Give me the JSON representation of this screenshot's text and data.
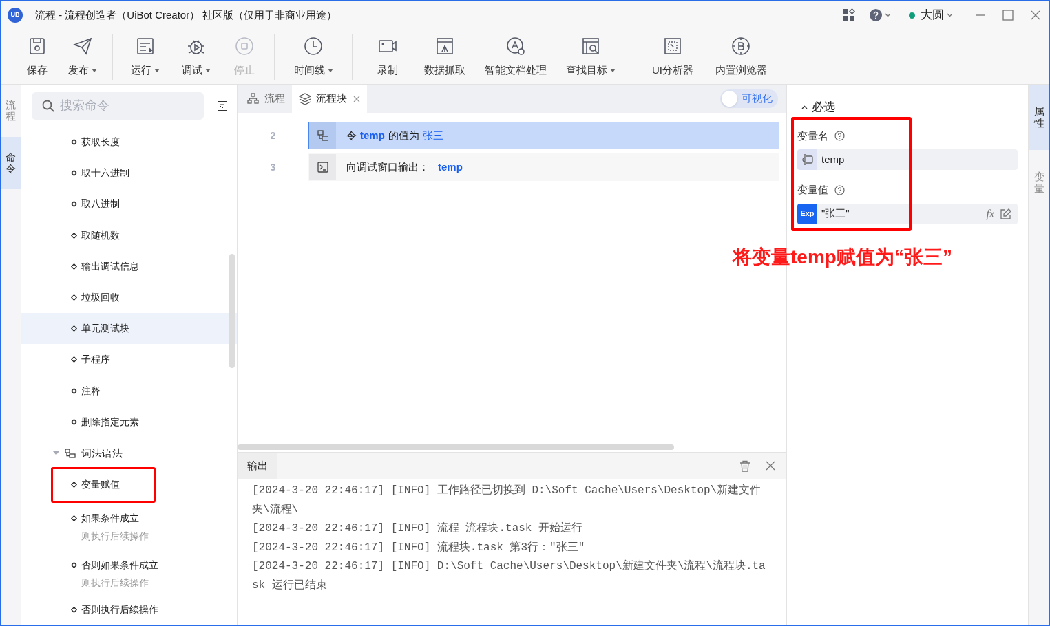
{
  "window": {
    "logo_text": "UB",
    "title": "流程 - 流程创造者（UiBot Creator） 社区版（仅用于非商业用途）",
    "user": {
      "name": "大圆",
      "color": "#0f9d7a"
    }
  },
  "toolbar": {
    "groups": [
      [
        {
          "label": "保存",
          "dropdown": false,
          "disabled": false
        },
        {
          "label": "发布",
          "dropdown": true,
          "disabled": false
        }
      ],
      [
        {
          "label": "运行",
          "dropdown": true,
          "disabled": false
        },
        {
          "label": "调试",
          "dropdown": true,
          "disabled": false
        },
        {
          "label": "停止",
          "dropdown": false,
          "disabled": true
        }
      ],
      [
        {
          "label": "时间线",
          "dropdown": true,
          "disabled": false
        }
      ],
      [
        {
          "label": "录制",
          "dropdown": false,
          "disabled": false
        },
        {
          "label": "数据抓取",
          "dropdown": false,
          "disabled": false
        },
        {
          "label": "智能文档处理",
          "dropdown": false,
          "disabled": false
        },
        {
          "label": "查找目标",
          "dropdown": true,
          "disabled": false
        }
      ],
      [
        {
          "label": "UI分析器",
          "dropdown": false,
          "disabled": false
        },
        {
          "label": "内置浏览器",
          "dropdown": false,
          "disabled": false
        }
      ]
    ]
  },
  "left_rail": {
    "tabs": [
      {
        "label": "流程",
        "selected": false
      },
      {
        "label": "命令",
        "selected": true
      }
    ]
  },
  "commands": {
    "search": {
      "placeholder": "搜索命令"
    },
    "items": [
      {
        "kind": "command",
        "label": "获取长度",
        "hovered": false,
        "boxed": false
      },
      {
        "kind": "command",
        "label": "取十六进制",
        "hovered": false,
        "boxed": false
      },
      {
        "kind": "command",
        "label": "取八进制",
        "hovered": false,
        "boxed": false
      },
      {
        "kind": "command",
        "label": "取随机数",
        "hovered": false,
        "boxed": false
      },
      {
        "kind": "command",
        "label": "输出调试信息",
        "hovered": false,
        "boxed": false
      },
      {
        "kind": "command",
        "label": "垃圾回收",
        "hovered": false,
        "boxed": false
      },
      {
        "kind": "command",
        "label": "单元测试块",
        "hovered": true,
        "boxed": false
      },
      {
        "kind": "command",
        "label": "子程序",
        "hovered": false,
        "boxed": false
      },
      {
        "kind": "command",
        "label": "注释",
        "hovered": false,
        "boxed": false
      },
      {
        "kind": "command",
        "label": "删除指定元素",
        "hovered": false,
        "boxed": false
      },
      {
        "kind": "group",
        "label": "词法语法",
        "expanded": true,
        "children": [
          {
            "kind": "command",
            "label": "变量赋值",
            "hovered": false,
            "boxed": true
          },
          {
            "kind": "command",
            "label": "如果条件成立",
            "subtitle": "则执行后续操作",
            "hovered": false,
            "boxed": false
          },
          {
            "kind": "command",
            "label": "否则如果条件成立",
            "subtitle": "则执行后续操作",
            "hovered": false,
            "boxed": false
          },
          {
            "kind": "command",
            "label": "否则执行后续操作",
            "hovered": false,
            "boxed": false
          }
        ]
      }
    ]
  },
  "editor": {
    "tabs": [
      {
        "label": "流程",
        "selected": false,
        "closable": false
      },
      {
        "label": "流程块",
        "selected": true,
        "closable": true
      }
    ],
    "toggle": {
      "label": "可视化",
      "on": false
    },
    "rows": [
      {
        "line": "2",
        "kind": "assign",
        "selected": true,
        "parts": [
          {
            "kind": "text",
            "text": "令"
          },
          {
            "kind": "var",
            "text": "temp"
          },
          {
            "kind": "text",
            "text": "的值为"
          },
          {
            "kind": "value",
            "text": "张三"
          }
        ]
      },
      {
        "line": "3",
        "kind": "print",
        "selected": false,
        "parts": [
          {
            "kind": "text",
            "text": "向调试窗口输出："
          },
          {
            "kind": "var",
            "text": "temp"
          }
        ]
      }
    ]
  },
  "output": {
    "title": "输出",
    "lines": [
      "[2024-3-20 22:46:17] [INFO] 工作路径已切换到 D:\\Soft Cache\\Users\\Desktop\\新建文件夹\\流程\\",
      "[2024-3-20 22:46:17] [INFO] 流程 流程块.task 开始运行",
      "[2024-3-20 22:46:17] [INFO] 流程块.task 第3行：\"张三\"",
      "[2024-3-20 22:46:17] [INFO] D:\\Soft Cache\\Users\\Desktop\\新建文件夹\\流程\\流程块.task 运行已结束"
    ]
  },
  "properties": {
    "section": "必选",
    "expanded": true,
    "boxed": true,
    "fields": [
      {
        "kind": "variable",
        "label": "变量名",
        "value": "temp"
      },
      {
        "kind": "expression",
        "label": "变量值",
        "badge": "Exp",
        "value": "\"张三\"",
        "function_button": "fx"
      }
    ]
  },
  "right_rail": {
    "tabs": [
      {
        "label": "属性",
        "selected": true
      },
      {
        "label": "变量",
        "selected": false
      }
    ]
  },
  "annotation": {
    "text": "将变量temp赋值为“张三”"
  }
}
